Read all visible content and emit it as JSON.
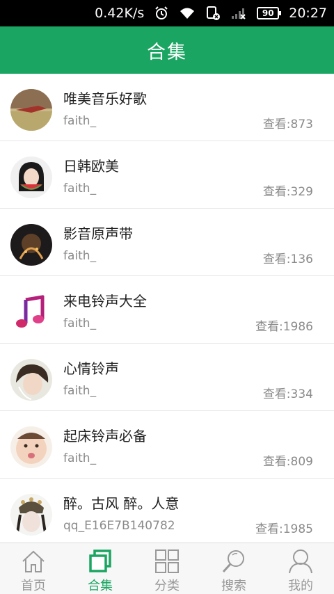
{
  "status_bar": {
    "speed": "0.42K/s",
    "battery": "90",
    "time": "20:27"
  },
  "header": {
    "title": "合集"
  },
  "collections": [
    {
      "title": "唯美音乐好歌",
      "author": "faith_",
      "views": "查看:873"
    },
    {
      "title": "日韩欧美",
      "author": "faith_",
      "views": "查看:329"
    },
    {
      "title": "影音原声带",
      "author": "faith_",
      "views": "查看:136"
    },
    {
      "title": "来电铃声大全",
      "author": "faith_",
      "views": "查看:1986"
    },
    {
      "title": "心情铃声",
      "author": "faith_",
      "views": "查看:334"
    },
    {
      "title": "起床铃声必备",
      "author": "faith_",
      "views": "查看:809"
    },
    {
      "title": "醉。古风 醉。人意",
      "author": "qq_E16E7B140782",
      "views": "查看:1985"
    }
  ],
  "bottom_nav": [
    {
      "label": "首页",
      "icon": "home-icon"
    },
    {
      "label": "合集",
      "icon": "collection-icon"
    },
    {
      "label": "分类",
      "icon": "grid-icon"
    },
    {
      "label": "搜索",
      "icon": "search-icon"
    },
    {
      "label": "我的",
      "icon": "user-icon"
    }
  ],
  "colors": {
    "accent": "#1ba562",
    "inactive": "#999999"
  }
}
